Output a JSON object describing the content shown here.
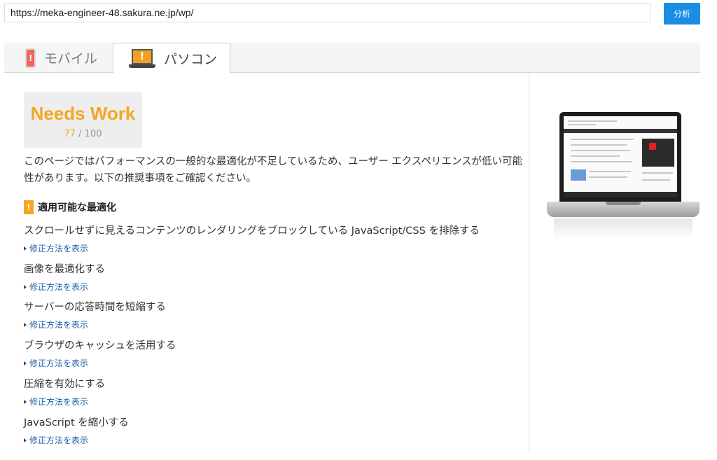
{
  "url_bar": {
    "value": "https://meka-engineer-48.sakura.ne.jp/wp/",
    "analyze_label": "分析"
  },
  "tabs": [
    {
      "label": "モバイル",
      "icon": "mobile-phone-warning-icon",
      "active": false
    },
    {
      "label": "パソコン",
      "icon": "laptop-warning-icon",
      "active": true
    }
  ],
  "score": {
    "rating": "Needs Work",
    "value": "77",
    "max": "/ 100",
    "color": "#f5a623"
  },
  "summary": "このページではパフォーマンスの一般的な最適化が不足しているため、ユーザー エクスペリエンスが低い可能性があります。以下の推奨事項をご確認ください。",
  "optimizations": {
    "heading": "適用可能な最適化",
    "show_fix_label": "修正方法を表示",
    "items": [
      {
        "title": "スクロールせずに見えるコンテンツのレンダリングをブロックしている JavaScript/CSS を排除する"
      },
      {
        "title": "画像を最適化する"
      },
      {
        "title": "サーバーの応答時間を短縮する"
      },
      {
        "title": "ブラウザのキャッシュを活用する"
      },
      {
        "title": "圧縮を有効にする"
      },
      {
        "title": "JavaScript を縮小する"
      }
    ]
  },
  "colors": {
    "accent_button": "#1a8ee2",
    "warning": "#f5a623",
    "link": "#1a5fa8"
  }
}
